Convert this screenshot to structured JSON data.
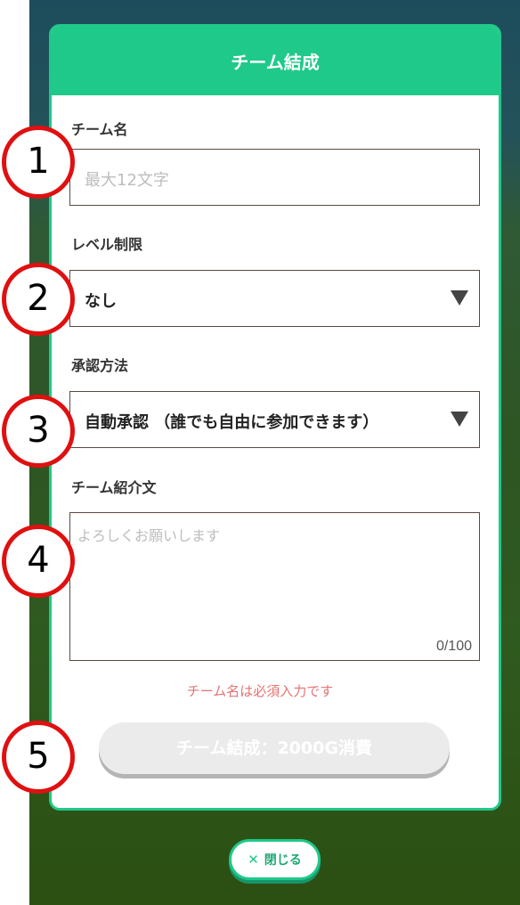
{
  "modal": {
    "title": "チーム結成"
  },
  "fields": {
    "team_name": {
      "label": "チーム名",
      "placeholder": "最大12文字"
    },
    "level_limit": {
      "label": "レベル制限",
      "value": "なし"
    },
    "approval": {
      "label": "承認方法",
      "value": "自動承認 （誰でも自由に参加できます）"
    },
    "intro": {
      "label": "チーム紹介文",
      "placeholder": "よろしくお願いします",
      "count": "0/100"
    }
  },
  "error_message": "チーム名は必須入力です",
  "submit_label": "チーム結成：2000G消費",
  "close_label": "閉じる",
  "markers": [
    "1",
    "2",
    "3",
    "4",
    "5"
  ],
  "colors": {
    "accent": "#1fc98a",
    "error": "#e57373",
    "marker": "#e01010"
  },
  "icons": {
    "close": "close-icon",
    "dropdown": "triangle-down-icon"
  }
}
